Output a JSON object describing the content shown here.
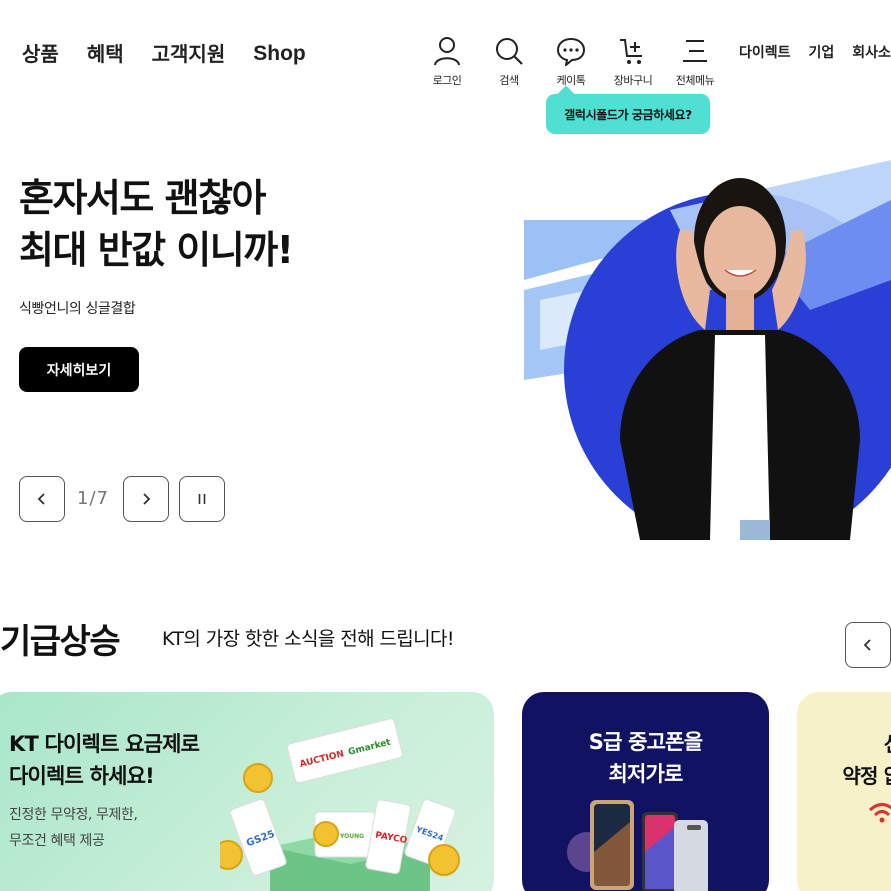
{
  "header": {
    "gnb": [
      "상품",
      "혜택",
      "고객지원",
      "Shop"
    ],
    "util": [
      {
        "label": "로그인",
        "icon": "user-icon"
      },
      {
        "label": "검색",
        "icon": "search-icon"
      },
      {
        "label": "케이톡",
        "icon": "chat-icon"
      },
      {
        "label": "장바구니",
        "icon": "cart-icon"
      },
      {
        "label": "전체메뉴",
        "icon": "menu-icon"
      }
    ],
    "toplinks": [
      "다이렉트",
      "기업",
      "회사소개"
    ],
    "tooltip": "갤럭시폴드가 궁금하세요?"
  },
  "hero": {
    "title_line1": "혼자서도 괜찮아",
    "title_line2": "최대 반값 이니까!",
    "subtitle": "식빵언니의 싱글결합",
    "button": "자세히보기",
    "counter": "1/7"
  },
  "section": {
    "title": "기급상승",
    "subtitle": "KT의 가장 핫한 소식을 전해 드립니다!"
  },
  "cards": [
    {
      "title_line1": "KT 다이렉트 요금제로",
      "title_line2": "다이렉트 하세요!",
      "desc_line1": "진정한 무약정, 무제한,",
      "desc_line2": "무조건 혜택 제공"
    },
    {
      "title_line1": "S급 중고폰을",
      "title_line2": "최저가로"
    },
    {
      "title_line1": "선물",
      "title_line2": "약정 없이"
    }
  ],
  "coupons": [
    "AUCTION",
    "Gmarket",
    "GS25",
    "OLIVE YOUNG",
    "PAYCO",
    "YES24"
  ],
  "colors": {
    "accent": "#4fe0d3",
    "hero_blue": "#2a3fd6",
    "card_navy": "#121262"
  }
}
